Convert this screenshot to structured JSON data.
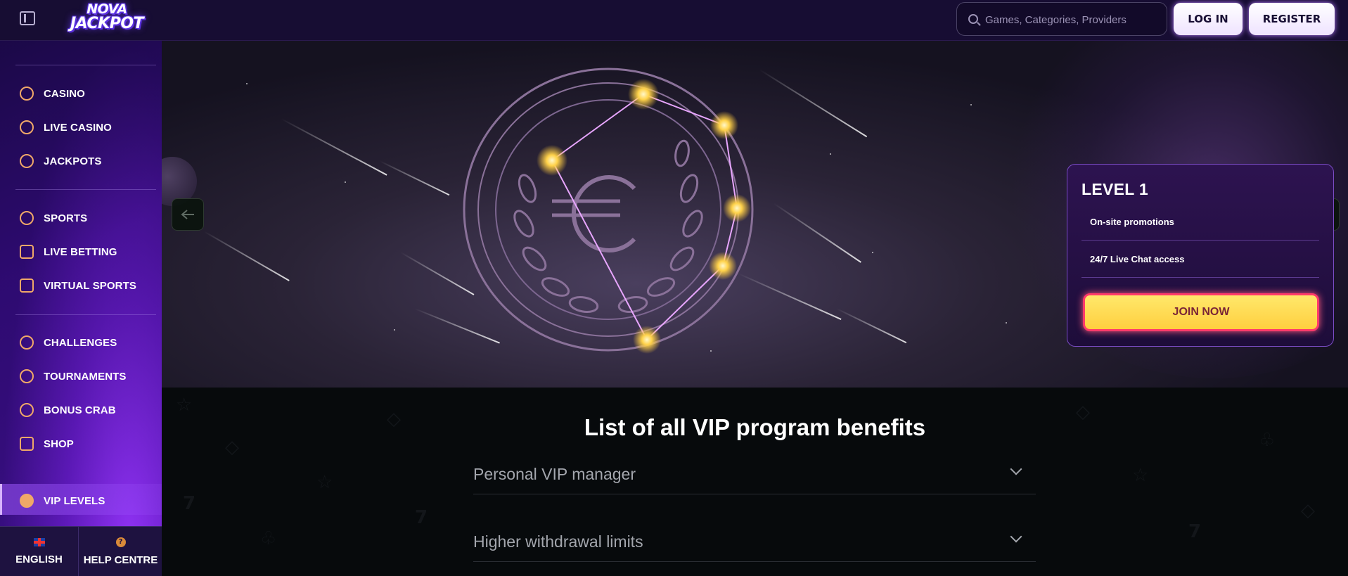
{
  "header": {
    "logo_line1": "NOVA",
    "logo_line2": "JACKPOT",
    "search_placeholder": "Games, Categories, Providers",
    "login_label": "LOG IN",
    "register_label": "REGISTER"
  },
  "sidebar": {
    "items": [
      {
        "label": "CASINO",
        "icon": "casino-chip-icon"
      },
      {
        "label": "LIVE CASINO",
        "icon": "spade-icon"
      },
      {
        "label": "JACKPOTS",
        "icon": "seven-icon"
      },
      {
        "label": "SPORTS",
        "icon": "ball-icon"
      },
      {
        "label": "LIVE BETTING",
        "icon": "play-icon"
      },
      {
        "label": "VIRTUAL SPORTS",
        "icon": "gamepad-icon"
      },
      {
        "label": "CHALLENGES",
        "icon": "medal-icon"
      },
      {
        "label": "TOURNAMENTS",
        "icon": "trophy-icon"
      },
      {
        "label": "BONUS CRAB",
        "icon": "crab-icon"
      },
      {
        "label": "SHOP",
        "icon": "shop-icon"
      },
      {
        "label": "VIP LEVELS",
        "icon": "diamond-icon"
      }
    ],
    "active": "VIP LEVELS",
    "language_label": "ENGLISH",
    "help_label": "HELP CENTRE",
    "help_glyph": "?"
  },
  "hero": {
    "level_title": "LEVEL 1",
    "benefits": [
      "On-site promotions",
      "24/7 Live Chat access"
    ],
    "join_label": "JOIN NOW"
  },
  "vip_benefits": {
    "title": "List of all VIP program benefits",
    "items": [
      "Personal VIP manager",
      "Higher withdrawal limits"
    ]
  },
  "colors": {
    "header_bg": "#170d33",
    "sidebar_accent": "#9b37ff",
    "icon_orange": "#f0a868",
    "join_yellow": "#ffd84a",
    "join_border": "#ff3a6b"
  }
}
